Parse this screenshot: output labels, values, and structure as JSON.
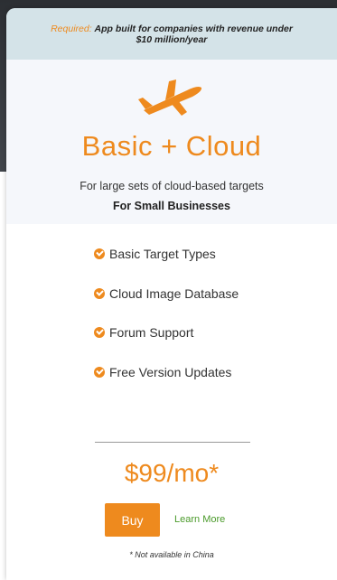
{
  "notice": {
    "required_label": "Required:",
    "text": "App built for companies with revenue under $10 million/year"
  },
  "plan": {
    "icon": "airplane-icon",
    "title": "Basic + Cloud",
    "description": "For large sets of cloud-based targets",
    "audience": "For Small Businesses"
  },
  "features": [
    "Basic Target Types",
    "Cloud Image Database",
    "Forum Support",
    "Free Version Updates"
  ],
  "pricing": {
    "price": "$99/mo*",
    "buy_label": "Buy",
    "learn_more_label": "Learn More",
    "footnote": "* Not available in China"
  },
  "colors": {
    "accent": "#ee8a1e",
    "link": "#4a9a2a",
    "notice_bg": "#d4e3e8",
    "header_bg": "#f5f7fb"
  }
}
